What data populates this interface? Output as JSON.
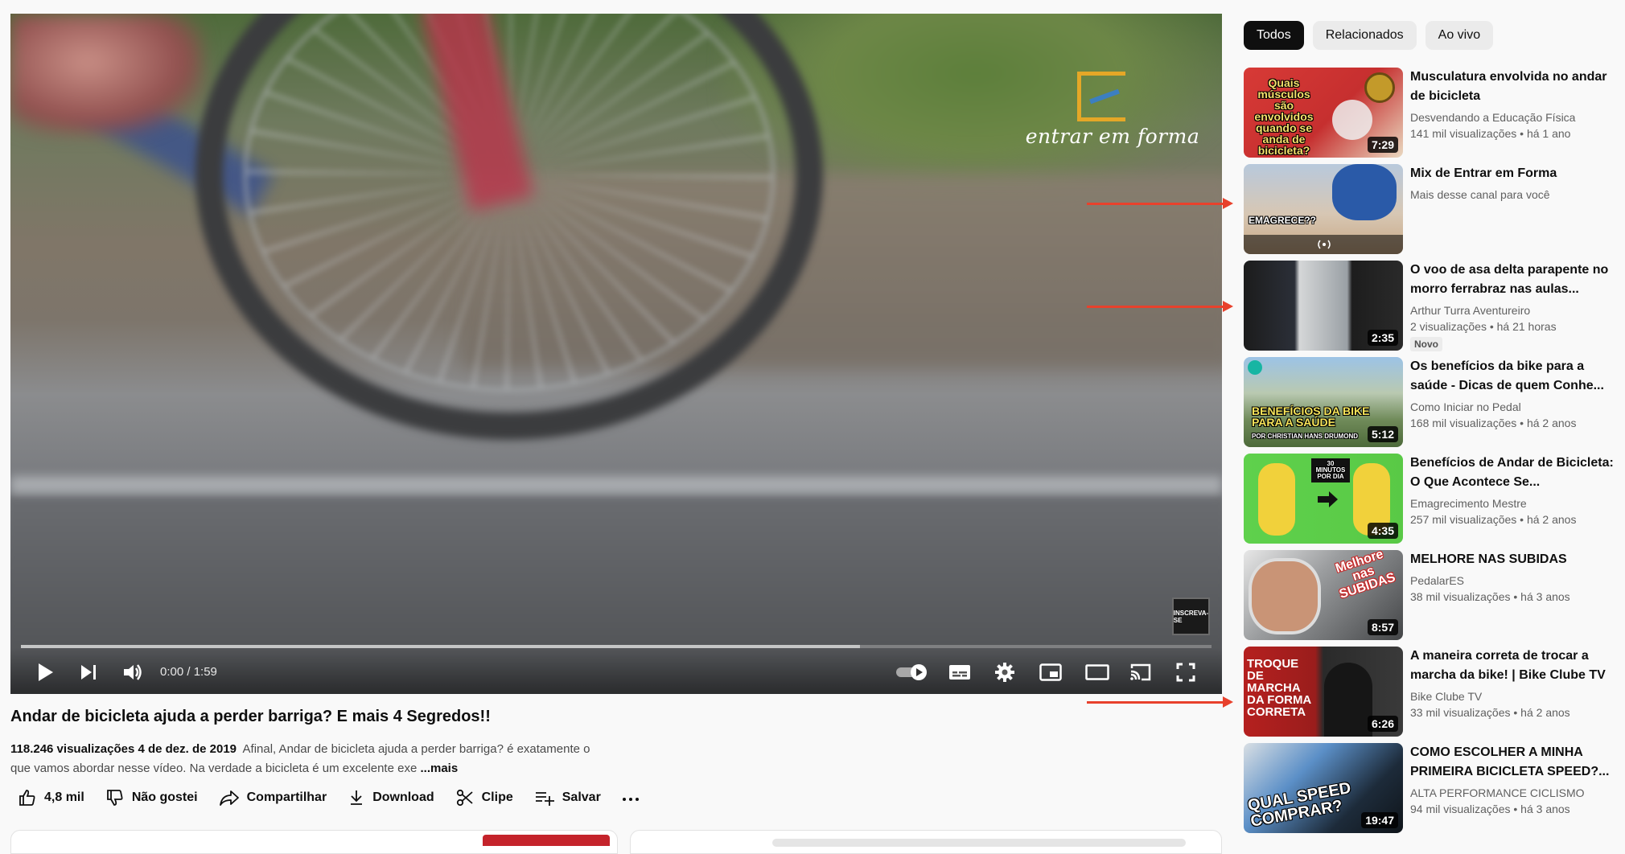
{
  "player": {
    "brand_text": "entrar em forma",
    "subscribe_badge": "INSCREVA-SE",
    "time": "0:00 / 1:59",
    "buffered_fraction": 0.705
  },
  "video": {
    "title": "Andar de bicicleta ajuda a perder barriga? E mais 4 Segredos!!",
    "stats": "118.246 visualizações  4 de dez. de 2019",
    "description": "Afinal, Andar de bicicleta ajuda a perder barriga? é exatamente o que vamos abordar nesse vídeo. Na verdade a bicicleta é um excelente exe",
    "more": "...mais"
  },
  "actions": {
    "like": "4,8 mil",
    "dislike": "Não gostei",
    "share": "Compartilhar",
    "download": "Download",
    "clip": "Clipe",
    "save": "Salvar",
    "more": "..."
  },
  "channel": {
    "name": "Entrar em Forma"
  },
  "chips": [
    "Todos",
    "Relacionados",
    "Ao vivo"
  ],
  "recommendations": [
    {
      "title": "Musculatura envolvida no andar de bicicleta",
      "channel": "Desvendando a Educação Física",
      "meta": "141 mil visualizações • há 1 ano",
      "duration": "7:29",
      "caption": "Quais músculos são envolvidos quando se anda de bicicleta?"
    },
    {
      "title": "Mix de Entrar em Forma",
      "channel": "Mais desse canal para você",
      "meta": "",
      "duration": "",
      "caption": "EMAGRECE??"
    },
    {
      "title": "O voo de asa delta parapente no morro ferrabraz nas aulas...",
      "channel": "Arthur Turra Aventureiro",
      "meta": "2 visualizações • há 21 horas",
      "duration": "2:35",
      "badge": "Novo"
    },
    {
      "title": "Os benefícios da bike para a saúde - Dicas de quem Conhe...",
      "channel": "Como Iniciar no Pedal",
      "meta": "168 mil visualizações • há 2 anos",
      "duration": "5:12",
      "caption": "BENEFÍCIOS DA BIKE PARA A SAÚDE",
      "caption2": "POR CHRISTIAN HANS DRUMOND"
    },
    {
      "title": "Benefícios de Andar de Bicicleta: O Que Acontece Se...",
      "channel": "Emagrecimento Mestre",
      "meta": "257 mil visualizações • há 2 anos",
      "duration": "4:35",
      "caption": "30 MINUTOS POR DIA"
    },
    {
      "title": "MELHORE NAS SUBIDAS",
      "channel": "PedalarES",
      "meta": "38 mil visualizações • há 3 anos",
      "duration": "8:57",
      "caption": "Melhore nas SUBIDAS"
    },
    {
      "title": "A maneira correta de trocar a marcha da bike! | Bike Clube TV",
      "channel": "Bike Clube TV",
      "meta": "33 mil visualizações • há 2 anos",
      "duration": "6:26",
      "caption": "TROQUE DE MARCHA DA FORMA CORRETA"
    },
    {
      "title": "COMO ESCOLHER A MINHA PRIMEIRA BICICLETA SPEED?...",
      "channel": "ALTA PERFORMANCE CICLISMO",
      "meta": "94 mil visualizações • há 3 anos",
      "duration": "19:47",
      "caption": "QUAL SPEED COMPRAR?"
    }
  ],
  "colors": {
    "accent_red": "#e8412c",
    "chip_active": "#0f0f0f",
    "subscribe": "#c4232b"
  }
}
